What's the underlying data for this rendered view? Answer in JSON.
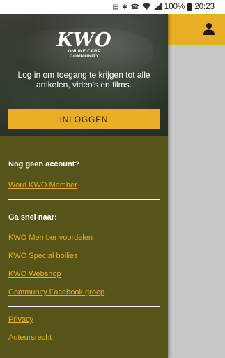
{
  "status_bar": {
    "battery": "100%",
    "time": "20:23",
    "icons": [
      "sim-icon",
      "bluetooth-icon",
      "call-icon",
      "wifi-icon",
      "signal-icon",
      "battery-icon"
    ]
  },
  "app_bar": {
    "profile_icon": "person-icon",
    "accent_color": "#e8ae24"
  },
  "drawer": {
    "logo": {
      "word": "KWO",
      "tagline": "ONLINE CARP COMMUNITY"
    },
    "intro_text": "Log in om toegang te krijgen tot alle artikelen, video's en films.",
    "login_button": "INLOGGEN",
    "no_account": {
      "title": "Nog geen account?",
      "link": "Word KWO Member"
    },
    "quick_nav": {
      "title": "Ga snel naar:",
      "links": [
        "KWO Member voordelen",
        "KWO Special boilies",
        "KWO Webshop",
        "Community Facebook groep"
      ]
    },
    "footer_links": [
      "Privacy",
      "Auteursrecht"
    ],
    "background_color": "#575419"
  }
}
